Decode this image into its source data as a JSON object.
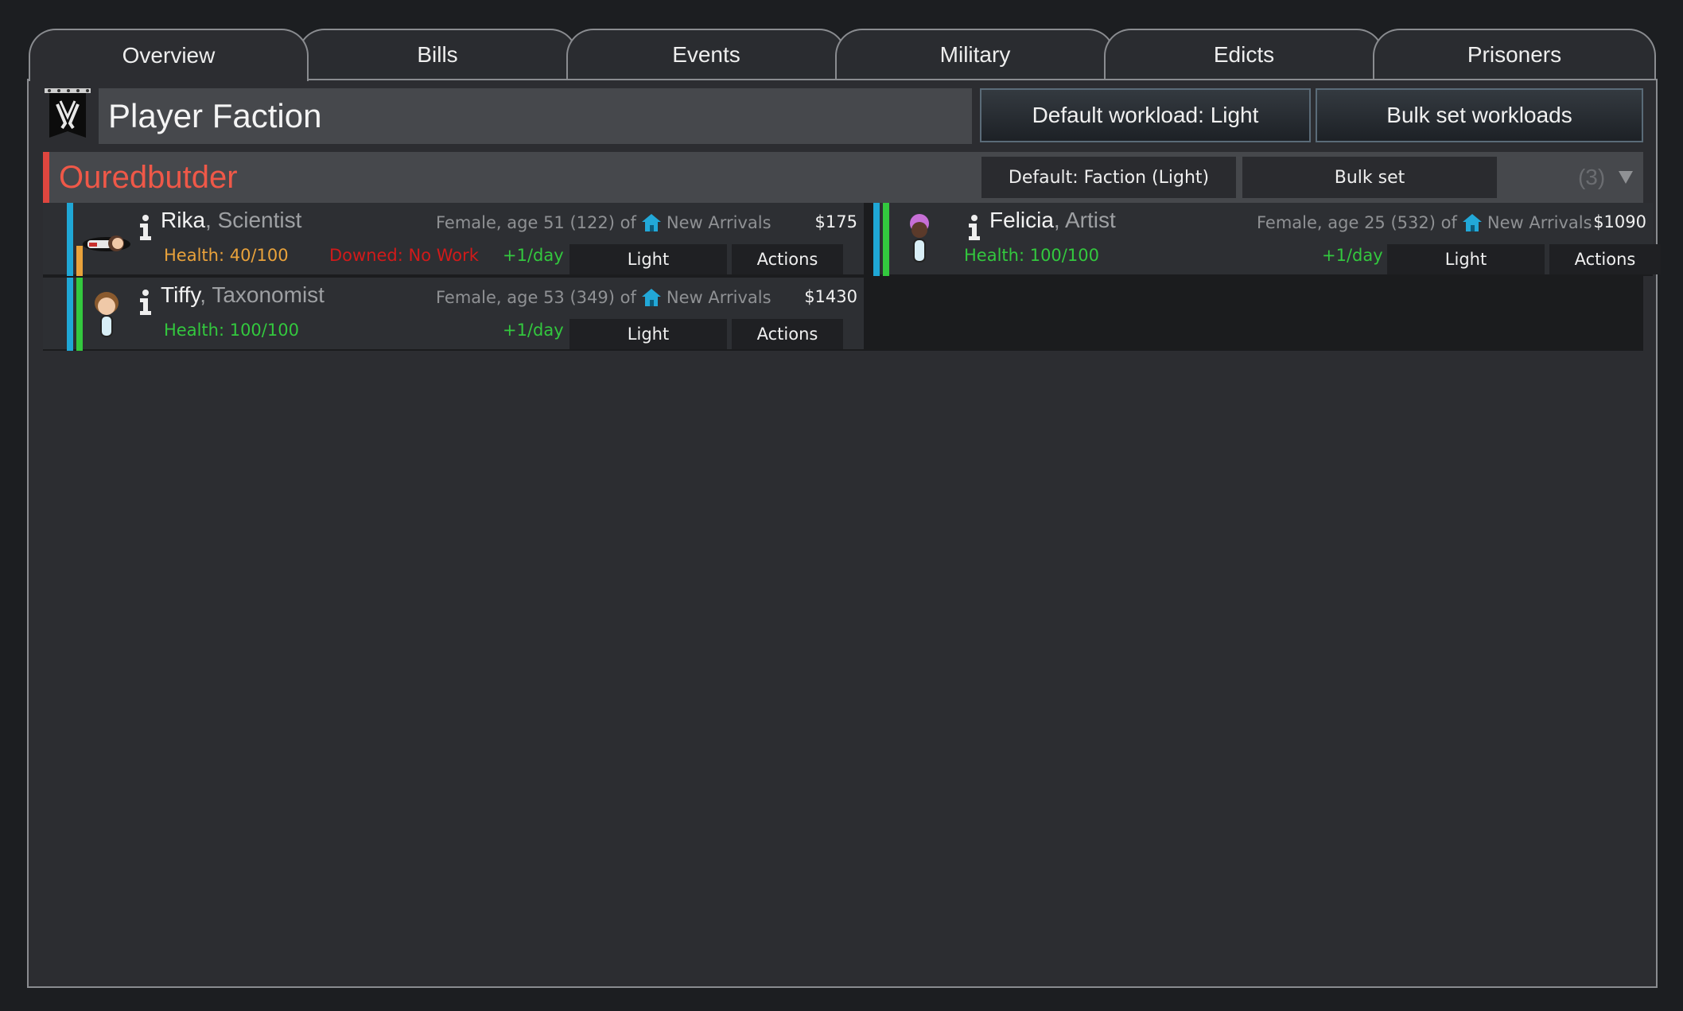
{
  "tabs": [
    "Overview",
    "Bills",
    "Events",
    "Military",
    "Edicts",
    "Prisoners"
  ],
  "active_tab": "Overview",
  "header": {
    "faction_name": "Player Faction",
    "default_workload": "Default workload: Light",
    "bulk_set_workloads": "Bulk set workloads"
  },
  "group": {
    "name": "Ouredbutder",
    "default_label": "Default: Faction (Light)",
    "bulk_set_label": "Bulk set",
    "count": "(3)",
    "collapse_icon": "triangle-down-icon",
    "accent_color": "#e0463f"
  },
  "pawns": [
    {
      "name": "Rika",
      "sep": ", ",
      "role": "Scientist",
      "desc": "Female, age 51 (122) of",
      "origin": "New Arrivals",
      "money": "$175",
      "health": "Health: 40/100",
      "health_color": "#e9a23b",
      "status": "Downed: No Work",
      "rate": "+1/day",
      "workload": "Light",
      "actions": "Actions"
    },
    {
      "name": "Felicia",
      "sep": ", ",
      "role": "Artist",
      "desc": "Female, age 25 (532) of",
      "origin": "New Arrivals",
      "money": "$1090",
      "health": "Health: 100/100",
      "health_color": "#33c83e",
      "status": "",
      "rate": "+1/day",
      "workload": "Light",
      "actions": "Actions"
    },
    {
      "name": "Tiffy",
      "sep": ", ",
      "role": "Taxonomist",
      "desc": "Female, age 53 (349) of",
      "origin": "New Arrivals",
      "money": "$1430",
      "health": "Health: 100/100",
      "health_color": "#33c83e",
      "status": "",
      "rate": "+1/day",
      "workload": "Light",
      "actions": "Actions"
    }
  ]
}
